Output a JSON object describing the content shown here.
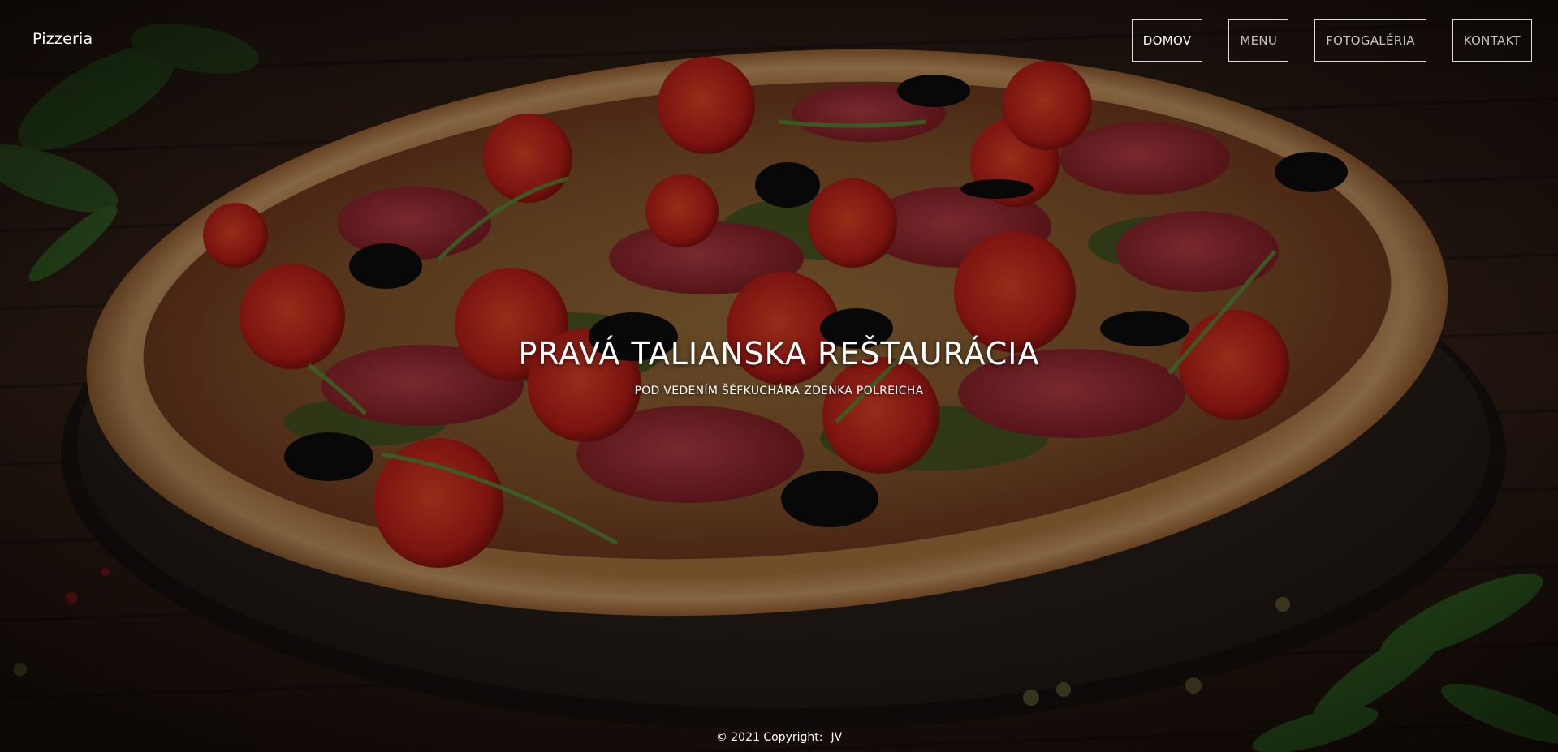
{
  "brand": "Pizzeria",
  "nav": {
    "items": [
      {
        "label": "DOMOV",
        "active": true
      },
      {
        "label": "MENU",
        "active": false
      },
      {
        "label": "FOTOGALÉRIA",
        "active": false
      },
      {
        "label": "KONTAKT",
        "active": false
      }
    ]
  },
  "hero": {
    "title": "PRAVÁ TALIANSKA REŠTAURÁCIA",
    "subtitle": "POD VEDENÍM ŠÉFKUCHÁRA ZDENKA POLREICHA",
    "background_image": "pizza-photo"
  },
  "footer": {
    "copyright": "© 2021 Copyright:",
    "author": "JV"
  }
}
